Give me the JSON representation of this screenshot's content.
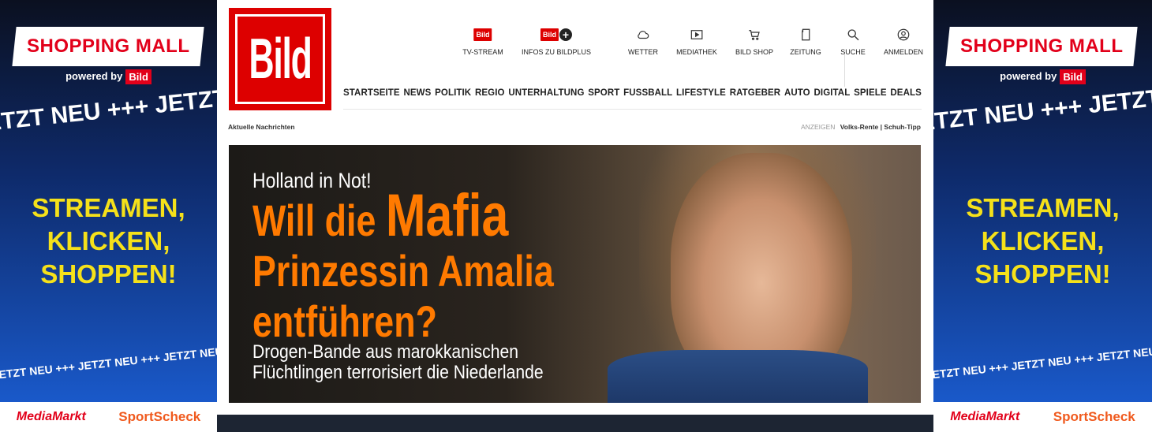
{
  "ad": {
    "badge": "SHOPPING MALL",
    "powered": "powered by",
    "powered_brand": "Bild",
    "ticker_top": "ETZT NEU +++ JETZT",
    "slogan": [
      "STREAMEN,",
      "KLICKEN,",
      "SHOPPEN!"
    ],
    "ticker_bottom": "JETZT NEU +++ JETZT NEU +++ JETZT NEU +",
    "brand_left": "MediaMarkt",
    "brand_right": "SportScheck",
    "colors": {
      "red": "#e2001a",
      "yellow": "#f5e11a"
    }
  },
  "logo": "Bild",
  "topbar": {
    "tv_icon_text": "Bild",
    "plus_icon_text": "Bild",
    "items": [
      {
        "label": "TV-STREAM",
        "icon": "bild-tv-icon"
      },
      {
        "label": "INFOS ZU BILDPLUS",
        "icon": "bild-plus-icon"
      },
      {
        "label": "WETTER",
        "icon": "cloud-icon"
      },
      {
        "label": "MEDIATHEK",
        "icon": "play-icon"
      },
      {
        "label": "BILD SHOP",
        "icon": "cart-icon"
      },
      {
        "label": "ZEITUNG",
        "icon": "newspaper-icon"
      },
      {
        "label": "SUCHE",
        "icon": "search-icon"
      },
      {
        "label": "ANMELDEN",
        "icon": "user-icon"
      }
    ]
  },
  "nav": [
    "STARTSEITE",
    "NEWS",
    "POLITIK",
    "REGIO",
    "UNTERHALTUNG",
    "SPORT",
    "FUSSBALL",
    "LIFESTYLE",
    "RATGEBER",
    "AUTO",
    "DIGITAL",
    "SPIELE",
    "DEALS"
  ],
  "subheader": {
    "left": "Aktuelle Nachrichten",
    "ads_label": "ANZEIGEN",
    "ad_link_1": "Volks-Rente",
    "separator": "|",
    "ad_link_2": "Schuh-Tipp"
  },
  "hero": {
    "kicker": "Holland in Not!",
    "line1_pre": "Will die",
    "line1_big": "Mafia",
    "line2": "Prinzessin Amalia",
    "line3": "entführen?",
    "deck1": "Drogen-Bande aus marokkanischen",
    "deck2": "Flüchtlingen terrorisiert die Niederlande",
    "headline_color": "#ff7a00"
  }
}
